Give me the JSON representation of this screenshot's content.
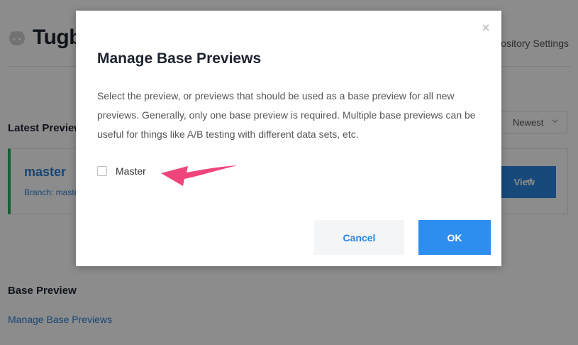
{
  "app": {
    "title": "Tugboat",
    "header_link": "Repository Settings",
    "logo_icon": "octocat-icon"
  },
  "latest_previews": {
    "title": "Latest Previews",
    "sort": {
      "selected": "Newest"
    },
    "cards": [
      {
        "name": "master",
        "branch": "Branch: master",
        "button_label": "View"
      }
    ]
  },
  "base_preview": {
    "title": "Base Preview",
    "manage_link": "Manage Base Previews"
  },
  "modal": {
    "title": "Manage Base Previews",
    "description": "Select the preview, or previews that should be used as a base preview for all new previews. Generally, only one base preview is required. Multiple base previews can be useful for things like A/B testing with different data sets, etc.",
    "options": [
      {
        "label": "Master",
        "checked": false
      }
    ],
    "cancel_label": "Cancel",
    "ok_label": "OK"
  },
  "colors": {
    "accent": "#2d8ef0",
    "link": "#2a7fd4",
    "success_border": "#27ae60",
    "annotation_arrow": "#f0457a",
    "overlay": "rgba(0,0,0,0.45)"
  }
}
